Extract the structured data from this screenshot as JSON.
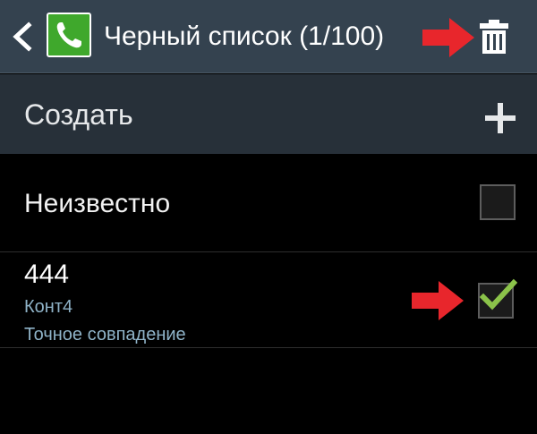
{
  "action_bar": {
    "title": "Черный список (1/100)",
    "icons": {
      "back": "chevron-left-icon",
      "app": "phone-icon",
      "delete": "trash-icon"
    },
    "colors": {
      "background": "#34424f",
      "app_icon": "#3fa82c",
      "annotation_arrow": "#e8262c"
    }
  },
  "create": {
    "label": "Создать",
    "icon": "plus-icon",
    "background": "#273039"
  },
  "list": {
    "unknown": {
      "label": "Неизвестно",
      "checked": false
    },
    "entries": [
      {
        "number": "444",
        "name": "Конт4",
        "match": "Точное совпадение",
        "checked": true
      }
    ]
  }
}
